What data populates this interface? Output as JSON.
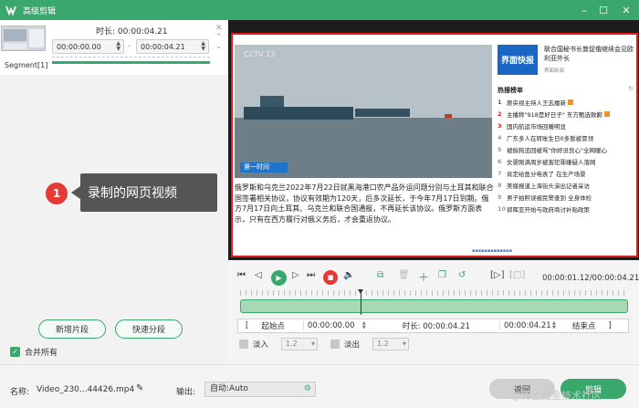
{
  "window": {
    "title": "高级剪辑",
    "minimize": "–",
    "maximize": "☐",
    "close": "✕"
  },
  "segment_panel": {
    "duration_label": "时长: 00:00:04.21",
    "start": "00:00:00.00",
    "sep": "-",
    "end": "00:00:04.21",
    "segment_label": "Segment[1]"
  },
  "callout": {
    "number": "1",
    "text": "录制的网页视频"
  },
  "left_buttons": {
    "add_segment": "新增片段",
    "quick_split": "快速分段"
  },
  "merge_all": {
    "label": "合并所有",
    "checked": true
  },
  "webpage": {
    "watermark": "CCTV 13",
    "caption": "第一时间",
    "article": "俄罗斯和乌克兰2022年7月22日就黑海港口农产品外运问题分别与土耳其和联合国签署相关协议，协议有效期为120天，后多次延长，于今年7月17日到期。俄方7月17日向土耳其、乌克兰和联合国通报，不再延长该协议。俄罗斯方面表示，只有在西方履行对俄义务后，才会重返协议。",
    "ad_logo": "界面快报",
    "headline": "联合国秘书长敦促俄继续会见欧利亚外长",
    "headline_source": "界面新闻",
    "hot_title": "热搜榜单",
    "hot_items": [
      {
        "n": "1",
        "text": "原央视主持人王志履新"
      },
      {
        "n": "2",
        "text": "主播称\"918是好日子\" 东方甄选致歉"
      },
      {
        "n": "3",
        "text": "国内航运市场回暖明显"
      },
      {
        "n": "4",
        "text": "广东多人在转账生日0多暂被冒领"
      },
      {
        "n": "5",
        "text": "被偷狗追回被骂\"你好没良心\"全网暖心"
      },
      {
        "n": "6",
        "text": "女婴刚满周岁被害犯罪嫌疑人落网"
      },
      {
        "n": "7",
        "text": "肯定给鱼分电表了 在生产场景"
      },
      {
        "n": "8",
        "text": "美媒报道上海街头演出记者采访"
      },
      {
        "n": "9",
        "text": "男子拍照误被民警查到 全身体检"
      },
      {
        "n": "10",
        "text": "郭晖亚开始与政府商讨补贴政策"
      }
    ],
    "loading": "▪▪▪▪▪▪▪▪▪▪▪▪▪"
  },
  "player": {
    "timecode": "00:00:01.12/00:00:04.21"
  },
  "trim": {
    "start_label": "起始点",
    "start_value": "00:00:00.00",
    "duration_label": "时长: 00:00:04.21",
    "end_value": "00:00:04.21",
    "end_label": "结束点"
  },
  "effects": {
    "fade_in": "淡入",
    "fade_in_value": "1.2",
    "fade_out": "淡出",
    "fade_out_value": "1.2"
  },
  "bottom": {
    "name_label": "名称:",
    "name_value": "Video_230...44426.mp4",
    "output_label": "输出:",
    "output_value": "自动:Auto",
    "back_button": "返回",
    "clip_button": "剪辑",
    "credit": "@稀土掘金技术社区"
  },
  "colors": {
    "accent": "#3aa76d",
    "record": "#e53935",
    "frame_border": "#e21b1b"
  }
}
